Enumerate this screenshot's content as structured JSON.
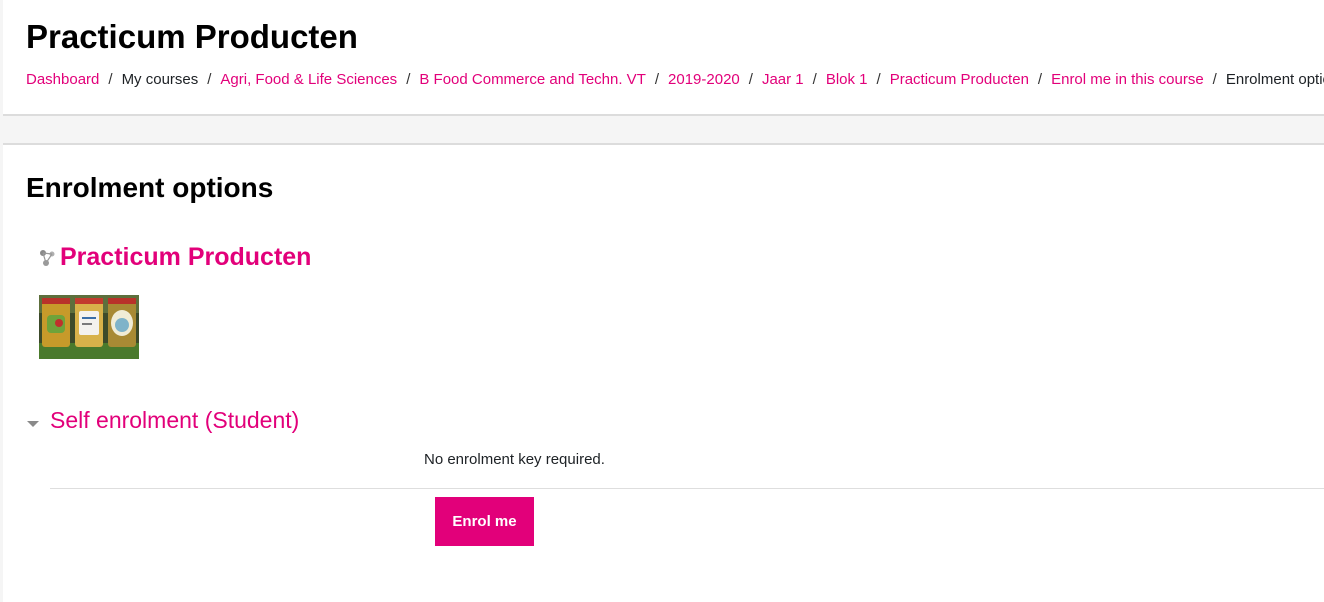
{
  "header": {
    "title": "Practicum Producten",
    "breadcrumb": [
      {
        "label": "Dashboard",
        "link": true
      },
      {
        "label": "My courses",
        "link": false
      },
      {
        "label": "Agri, Food & Life Sciences",
        "link": true
      },
      {
        "label": "B Food Commerce and Techn. VT",
        "link": true
      },
      {
        "label": "2019-2020",
        "link": true
      },
      {
        "label": "Jaar 1",
        "link": true
      },
      {
        "label": "Blok 1",
        "link": true
      },
      {
        "label": "Practicum Producten",
        "link": true
      },
      {
        "label": "Enrol me in this course",
        "link": true
      },
      {
        "label": "Enrolment options",
        "link": false
      }
    ],
    "separator": "/"
  },
  "main": {
    "heading": "Enrolment options",
    "course": {
      "name": "Practicum Producten",
      "icon": "course-network-icon",
      "image": "jam-jars-thumbnail"
    },
    "self_enrolment": {
      "heading": "Self enrolment (Student)",
      "icon": "collapse-triangle-icon",
      "info": "No enrolment key required.",
      "button_label": "Enrol me"
    }
  },
  "colors": {
    "accent": "#e2007a",
    "text": "#1d2125",
    "page_background": "#f5f5f5",
    "border": "#dcdcdc"
  }
}
